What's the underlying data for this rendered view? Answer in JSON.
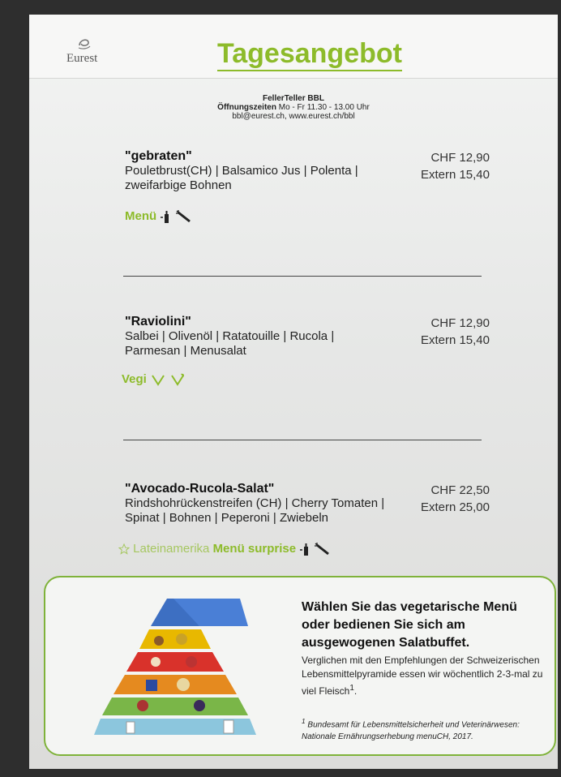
{
  "header": {
    "logo_text": "Eurest",
    "title": "Tagesangebot"
  },
  "info": {
    "venue": "FellerTeller BBL",
    "hours_label": "Öffnungszeiten",
    "hours_value": "Mo - Fr 11.30 - 13.00 Uhr",
    "contact": "bbl@eurest.ch, www.eurest.ch/bbl"
  },
  "menu": [
    {
      "name": "\"gebraten\"",
      "description": "Pouletbrust(CH) | Balsamico Jus | Polenta | zweifarbige Bohnen",
      "price": "CHF 12,90",
      "price_extern": "Extern 15,40",
      "tag": "Menü",
      "icons": [
        "bottle-icon",
        "carrot-icon"
      ]
    },
    {
      "name": "\"Raviolini\"",
      "description": "Salbei | Olivenöl | Ratatouille | Rucola | Parmesan | Menusalat",
      "price": "CHF 12,90",
      "price_extern": "Extern 15,40",
      "tag": "Vegi",
      "icons": [
        "vegetarian-icon",
        "vegan-icon"
      ]
    },
    {
      "name": "\"Avocado-Rucola-Salat\"",
      "description": "Rindshohrückenstreifen (CH) | Cherry Tomaten | Spinat | Bohnen | Peperoni | Zwiebeln",
      "price": "CHF 22,50",
      "price_extern": "Extern 25,00",
      "tag_prefix": "Lateinamerika",
      "tag": "Menü surprise",
      "icons": [
        "star-icon",
        "bottle-icon",
        "carrot-icon"
      ]
    }
  ],
  "panel": {
    "headline": "Wählen Sie das vegetarische Menü oder bedienen Sie sich am ausgewogenen Salatbuffet.",
    "body": "Verglichen mit den Empfehlungen der Schweizerischen Lebensmittelpyramide essen wir wöchentlich 2-3-mal zu viel Fleisch",
    "body_sup": "1",
    "body_end": ".",
    "footnote_num": "1",
    "footnote": "Bundesamt für Lebensmittelsicherheit und Veterinärwesen: Nationale Ernährungserhebung menuCH, 2017.",
    "pyramid_icon": "food-pyramid-icon"
  },
  "colors": {
    "brand_green": "#8dbb2a",
    "panel_border": "#7fb23a"
  }
}
